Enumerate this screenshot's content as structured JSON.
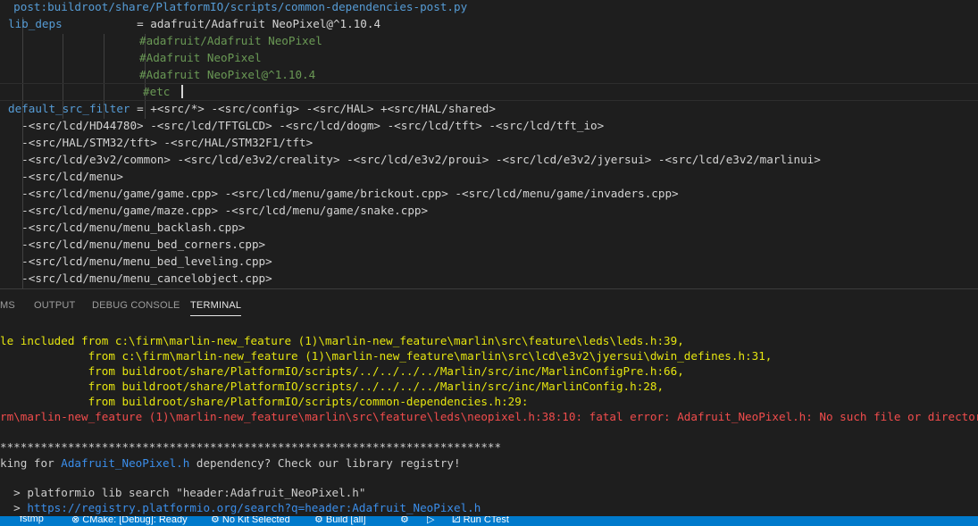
{
  "editor": {
    "lines": [
      {
        "a": "  post:buildroot/share/PlatformIO/scripts/common-dependencies-post.py",
        "b": "",
        "c": ""
      },
      {
        "a": "lib_deps",
        "b": "           = adafruit/Adafruit NeoPixel@^1.10.4",
        "c": ""
      },
      {
        "a": "",
        "b": "",
        "c": "                   #adafruit/Adafruit NeoPixel"
      },
      {
        "a": "",
        "b": "",
        "c": "                   #Adafruit NeoPixel"
      },
      {
        "a": "",
        "b": "",
        "c": "                   #Adafruit NeoPixel@^1.10.4"
      },
      {
        "a": "",
        "b": "",
        "c": "                   #etc"
      },
      {
        "a": "default_src_filter",
        "b": " = +<src/*> -<src/config> -<src/HAL> +<src/HAL/shared>",
        "c": ""
      },
      {
        "a": "",
        "b": "  -<src/lcd/HD44780> -<src/lcd/TFTGLCD> -<src/lcd/dogm> -<src/lcd/tft> -<src/lcd/tft_io>",
        "c": ""
      },
      {
        "a": "",
        "b": "  -<src/HAL/STM32/tft> -<src/HAL/STM32F1/tft>",
        "c": ""
      },
      {
        "a": "",
        "b": "  -<src/lcd/e3v2/common> -<src/lcd/e3v2/creality> -<src/lcd/e3v2/proui> -<src/lcd/e3v2/jyersui> -<src/lcd/e3v2/marlinui>",
        "c": ""
      },
      {
        "a": "",
        "b": "  -<src/lcd/menu>",
        "c": ""
      },
      {
        "a": "",
        "b": "  -<src/lcd/menu/game/game.cpp> -<src/lcd/menu/game/brickout.cpp> -<src/lcd/menu/game/invaders.cpp>",
        "c": ""
      },
      {
        "a": "",
        "b": "  -<src/lcd/menu/game/maze.cpp> -<src/lcd/menu/game/snake.cpp>",
        "c": ""
      },
      {
        "a": "",
        "b": "  -<src/lcd/menu/menu_backlash.cpp>",
        "c": ""
      },
      {
        "a": "",
        "b": "  -<src/lcd/menu/menu_bed_corners.cpp>",
        "c": ""
      },
      {
        "a": "",
        "b": "  -<src/lcd/menu/menu_bed_leveling.cpp>",
        "c": ""
      },
      {
        "a": "",
        "b": "  -<src/lcd/menu/menu_cancelobject.cpp>",
        "c": ""
      }
    ]
  },
  "panel": {
    "tabs": {
      "problems": "MS",
      "output": "OUTPUT",
      "debug_console": "DEBUG CONSOLE",
      "terminal": "TERMINAL"
    }
  },
  "terminal": {
    "lines": [
      {
        "a": "le included from c:\\firm\\marlin-new_feature (1)\\marlin-new_feature\\marlin\\src\\feature\\leds\\leds.h:39,",
        "b": "",
        "c": ""
      },
      {
        "a": "             from c:\\firm\\marlin-new_feature (1)\\marlin-new_feature\\marlin\\src\\lcd\\e3v2\\jyersui\\dwin_defines.h:31,",
        "b": "",
        "c": ""
      },
      {
        "a": "             from buildroot/share/PlatformIO/scripts/../../../../Marlin/src/inc/MarlinConfigPre.h:66,",
        "b": "",
        "c": ""
      },
      {
        "a": "             from buildroot/share/PlatformIO/scripts/../../../../Marlin/src/inc/MarlinConfig.h:28,",
        "b": "",
        "c": ""
      },
      {
        "a": "             from buildroot/share/PlatformIO/scripts/common-dependencies.h:29:",
        "b": "",
        "c": ""
      },
      {
        "a": "rm\\marlin-new_feature (1)\\marlin-new_feature\\marlin\\src\\feature\\leds\\neopixel.h:38:10: fatal error: Adafruit_NeoPixel.h: No such file or directory",
        "b": "",
        "c": ""
      },
      {
        "a": "",
        "b": "",
        "c": ""
      },
      {
        "a": "**************************************************************************",
        "b": "",
        "c": ""
      },
      {
        "a": "king for ",
        "b": "Adafruit_NeoPixel.h",
        "c": " dependency? Check our library registry!"
      },
      {
        "a": "",
        "b": "",
        "c": ""
      },
      {
        "a": "  > platformio lib search \"header:Adafruit_NeoPixel.h\"",
        "b": "",
        "c": ""
      },
      {
        "a": "  > ",
        "b": "https://registry.platformio.org/search?q=header:Adafruit_NeoPixel.h",
        "c": ""
      }
    ]
  },
  "statusbar": {
    "items": [
      "fstmp",
      "⊗ CMake: [Debug]: Ready",
      "⚙ No Kit Selected",
      "⚙ Build  [all]",
      "⚙",
      "▷",
      "⚂ Run CTest"
    ]
  },
  "colors": {
    "keyword": "#569cd6",
    "comment": "#6a9955",
    "warning": "#e5e510",
    "error": "#f14c4c",
    "link": "#3b8eea",
    "statusbar": "#007acc"
  },
  "icons": [
    "terminal-tab-underline",
    "cmake-icon",
    "gear-icon",
    "play-icon",
    "beaker-icon"
  ]
}
